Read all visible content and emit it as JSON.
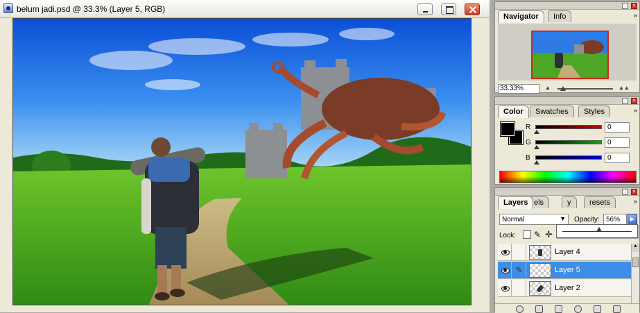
{
  "document": {
    "title": "belum jadi.psd @ 33.3% (Layer 5, RGB)"
  },
  "navigator": {
    "tabs": [
      "Navigator",
      "Info"
    ],
    "zoom": "33.33%"
  },
  "color": {
    "tabs": [
      "Color",
      "Swatches",
      "Styles"
    ],
    "channels": [
      {
        "label": "R",
        "value": "0",
        "color": "#cc0000"
      },
      {
        "label": "G",
        "value": "0",
        "color": "#00b000"
      },
      {
        "label": "B",
        "value": "0",
        "color": "#0000cc"
      }
    ]
  },
  "layers": {
    "tabs": [
      "Layers",
      "els",
      "y",
      "resets"
    ],
    "blend_mode": "Normal",
    "opacity_label": "Opacity:",
    "opacity": "56%",
    "lock_label": "Lock:",
    "items": [
      {
        "name": "Layer 4",
        "selected": false
      },
      {
        "name": "Layer 5",
        "selected": true
      },
      {
        "name": "Layer 2",
        "selected": false
      }
    ]
  },
  "colors": {
    "selection": "#3c8ee6",
    "navigator_frame": "#cc2b1a"
  }
}
